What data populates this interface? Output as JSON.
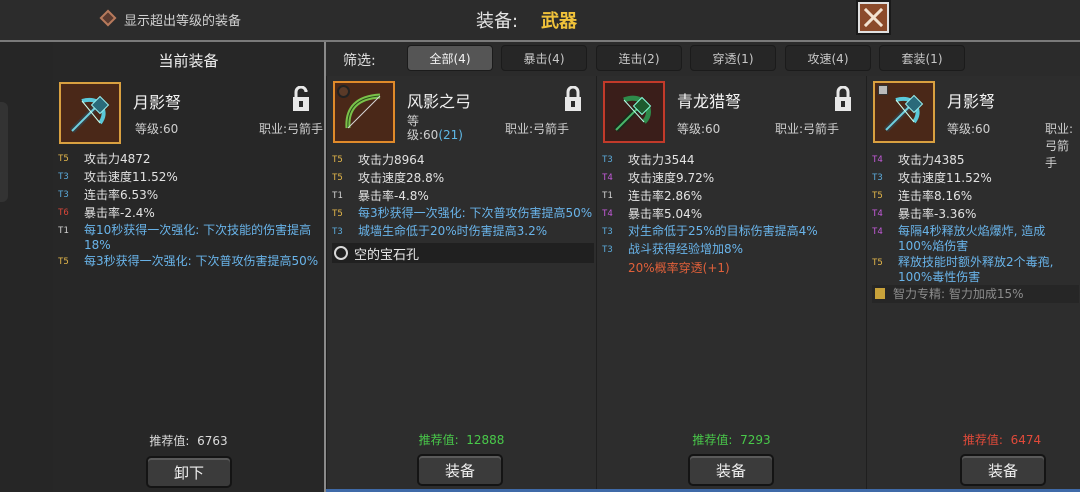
{
  "topbar": {
    "toggle_label": "显示超出等级的装备",
    "title_label": "装备:",
    "title_value": "武器"
  },
  "current": {
    "header": "当前装备",
    "name": "月影弩",
    "level": "等级:60",
    "class": "职业:弓箭手",
    "stats": [
      {
        "tier": "T5",
        "text": "攻击力4872"
      },
      {
        "tier": "T3",
        "text": "攻击速度11.52%"
      },
      {
        "tier": "T3",
        "text": "连击率6.53%"
      },
      {
        "tier": "T6",
        "text": "暴击率-2.4%"
      },
      {
        "tier": "T1",
        "text": "每10秒获得一次强化: 下次技能的伤害提高18%"
      },
      {
        "tier": "T5",
        "text": "每3秒获得一次强化: 下次普攻伤害提高50%"
      }
    ],
    "rec_label": "推荐值:",
    "rec_value": "6763",
    "button": "卸下"
  },
  "filter": {
    "label": "筛选:",
    "tabs": [
      "全部(4)",
      "暴击(4)",
      "连击(2)",
      "穿透(1)",
      "攻速(4)",
      "套装(1)"
    ]
  },
  "items": [
    {
      "name": "风影之弓",
      "level_a": "等",
      "level_b": "级:60",
      "level_extra": "(21)",
      "class": "职业:弓箭手",
      "stats": [
        {
          "tier": "T5",
          "text": "攻击力8964"
        },
        {
          "tier": "T5",
          "text": "攻击速度28.8%"
        },
        {
          "tier": "T1",
          "text": "暴击率-4.8%"
        },
        {
          "tier": "T5",
          "text": "每3秒获得一次强化: 下次普攻伤害提高50%"
        },
        {
          "tier": "T3",
          "text": "城墙生命低于20%时伤害提高3.2%"
        }
      ],
      "socket": "空的宝石孔",
      "rec_label": "推荐值:",
      "rec_value": "12888",
      "button": "装备"
    },
    {
      "name": "青龙猎弩",
      "level": "等级:60",
      "class": "职业:弓箭手",
      "stats": [
        {
          "tier": "T3",
          "text": "攻击力3544"
        },
        {
          "tier": "T4",
          "text": "攻击速度9.72%"
        },
        {
          "tier": "T1",
          "text": "连击率2.86%"
        },
        {
          "tier": "T4",
          "text": "暴击率5.04%"
        },
        {
          "tier": "T3",
          "text": "对生命低于25%的目标伤害提高4%"
        },
        {
          "tier": "T3",
          "text": "战斗获得经验增加8%"
        }
      ],
      "extra": "20%概率穿透(+1)",
      "rec_label": "推荐值:",
      "rec_value": "7293",
      "button": "装备"
    },
    {
      "name": "月影弩",
      "level": "等级:60",
      "class": "职业:弓箭手",
      "stats": [
        {
          "tier": "T4",
          "text": "攻击力4385"
        },
        {
          "tier": "T3",
          "text": "攻击速度11.52%"
        },
        {
          "tier": "T5",
          "text": "连击率8.16%"
        },
        {
          "tier": "T4",
          "text": "暴击率-3.36%"
        },
        {
          "tier": "T4",
          "text": "每隔4秒释放火焰爆炸, 造成100%焰伤害"
        },
        {
          "tier": "T5",
          "text": "释放技能时额外释放2个毒孢, 100%毒性伤害"
        }
      ],
      "set_bonus": "智力专精: 智力加成15%",
      "rec_label": "推荐值:",
      "rec_value": "6474",
      "button": "装备"
    }
  ],
  "colors": {
    "accent": "#f0c23a",
    "tier_t5": "#e0b44a",
    "tier_t3": "#5aa8d8",
    "tier_t4": "#c25ad8",
    "tier_t6": "#d9463a",
    "rec_green": "#49c94a",
    "rec_red": "#e04a3a"
  },
  "icons": {
    "close": "close-x-icon",
    "lock_open": "unlocked-padlock-icon",
    "lock_closed": "locked-padlock-icon",
    "crossbow": "crossbow-icon",
    "bow": "bow-icon"
  }
}
